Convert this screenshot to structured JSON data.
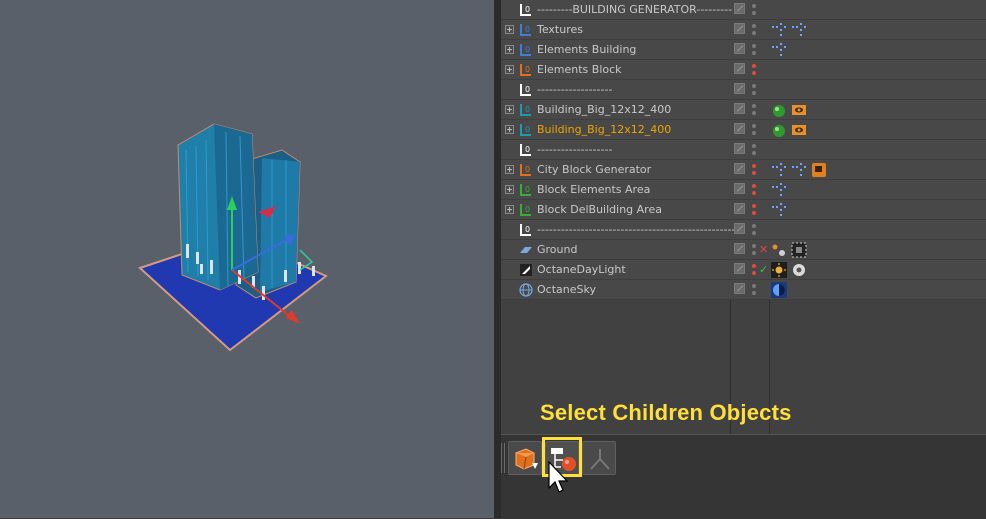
{
  "objects": [
    {
      "name": "---------BUILDING GENERATOR---------",
      "icon": "null-object-icon",
      "icon_color": "#ffffff",
      "expandable": false,
      "dots": "gray",
      "tags": []
    },
    {
      "name": "Textures",
      "icon": "null-object-icon",
      "icon_color": "#3d7fd9",
      "expandable": true,
      "dots": "gray",
      "tags": [
        "cloner-tag-icon",
        "cloner-tag-icon"
      ]
    },
    {
      "name": "Elements Building",
      "icon": "null-object-icon",
      "icon_color": "#3d7fd9",
      "expandable": true,
      "dots": "gray",
      "tags": [
        "cloner-tag-icon"
      ]
    },
    {
      "name": "Elements Block",
      "icon": "null-object-icon",
      "icon_color": "#e0701c",
      "expandable": true,
      "dots": "red",
      "tags": []
    },
    {
      "name": "-------------------",
      "icon": "null-object-icon",
      "icon_color": "#ffffff",
      "expandable": false,
      "dots": "gray",
      "tags": []
    },
    {
      "name": "Building_Big_12x12_400",
      "icon": "null-object-icon",
      "icon_color": "#1e9bb0",
      "expandable": true,
      "dots": "gray",
      "tags": [
        "phong-tag-icon",
        "display-tag-icon"
      ]
    },
    {
      "name": "Building_Big_12x12_400",
      "icon": "null-object-icon",
      "icon_color": "#1e9bb0",
      "expandable": true,
      "dots": "gray",
      "selected": true,
      "tags": [
        "phong-tag-icon",
        "display-tag-icon"
      ]
    },
    {
      "name": "-------------------",
      "icon": "null-object-icon",
      "icon_color": "#ffffff",
      "expandable": false,
      "dots": "gray",
      "tags": []
    },
    {
      "name": "City Block Generator",
      "icon": "null-object-icon",
      "icon_color": "#e0701c",
      "expandable": true,
      "dots": "red",
      "tags": [
        "cloner-tag-icon",
        "cloner-tag-icon",
        "script-tag-icon"
      ]
    },
    {
      "name": "Block Elements Area",
      "icon": "null-object-icon",
      "icon_color": "#35b035",
      "expandable": true,
      "dots": "red",
      "tags": [
        "cloner-tag-icon"
      ]
    },
    {
      "name": "Block DelBuilding Area",
      "icon": "null-object-icon",
      "icon_color": "#35b035",
      "expandable": true,
      "dots": "red",
      "tags": [
        "cloner-tag-icon"
      ]
    },
    {
      "name": "--------------------------------------------------",
      "icon": "null-object-icon",
      "icon_color": "#ffffff",
      "expandable": false,
      "dots": "gray",
      "tags": []
    },
    {
      "name": "Ground",
      "icon": "plane-icon",
      "icon_color": "#7aa8e0",
      "expandable": false,
      "dots": "gray",
      "mark": "x",
      "tags": [
        "material-tag-icon",
        "checker-tag-icon"
      ]
    },
    {
      "name": "OctaneDayLight",
      "icon": "daylight-icon",
      "icon_color": "#ffffff",
      "expandable": false,
      "dots": "red",
      "mark": "check",
      "tags": [
        "sun-tag-icon",
        "gear-tag-icon"
      ]
    },
    {
      "name": "OctaneSky",
      "icon": "sky-icon",
      "icon_color": "#7aa8e0",
      "expandable": false,
      "dots": "gray",
      "tags": [
        "sky-tag-icon"
      ]
    }
  ],
  "caption": "Select Children Objects",
  "toolbar": {
    "buttons": [
      "select-objects-icon",
      "select-children-icon",
      "select-hierarchy-icon"
    ]
  },
  "colors": {
    "highlight": "#ffe03a",
    "selected_text": "#f0a400"
  }
}
